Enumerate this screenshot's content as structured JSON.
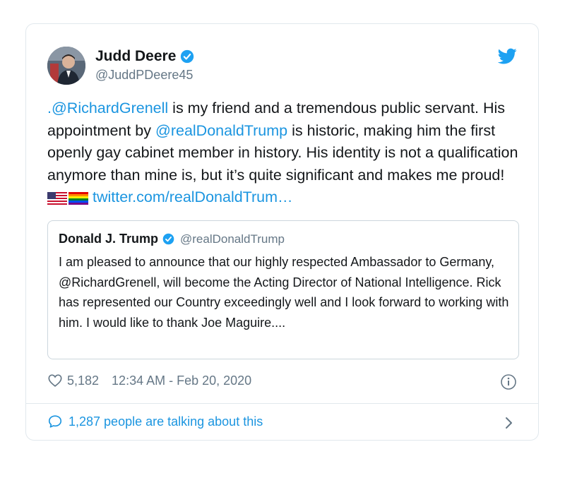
{
  "author": {
    "name": "Judd Deere",
    "handle": "@JuddPDeere45"
  },
  "tweet": {
    "segments": [
      {
        "text": ".@RichardGrenell",
        "link": true
      },
      {
        "text": " is my friend and a tremendous public servant. His appointment by ",
        "link": false
      },
      {
        "text": "@realDonaldTrump",
        "link": true
      },
      {
        "text": " is historic, making him the first openly gay cabinet member in history. His identity is not a qualification anymore than mine is, but it’s quite significant and makes me proud! ",
        "link": false
      }
    ],
    "emoji_icons": [
      "us-flag-icon",
      "rainbow-flag-icon"
    ],
    "url_text": "twitter.com/realDonaldTrum…"
  },
  "quoted": {
    "name": "Donald J. Trump",
    "handle": "@realDonaldTrump",
    "text": "I am pleased to announce that our highly respected Ambassador to Germany, @RichardGrenell, will become the Acting Director of National Intelligence. Rick has represented our Country exceedingly well and I look forward to working with him. I would like to thank Joe Maguire...."
  },
  "meta": {
    "likes": "5,182",
    "timestamp": "12:34 AM - Feb 20, 2020"
  },
  "footer": {
    "talking": "1,287 people are talking about this"
  },
  "colors": {
    "link": "#1b95e0",
    "secondary_text": "#657786",
    "border": "#e1e8ed"
  }
}
